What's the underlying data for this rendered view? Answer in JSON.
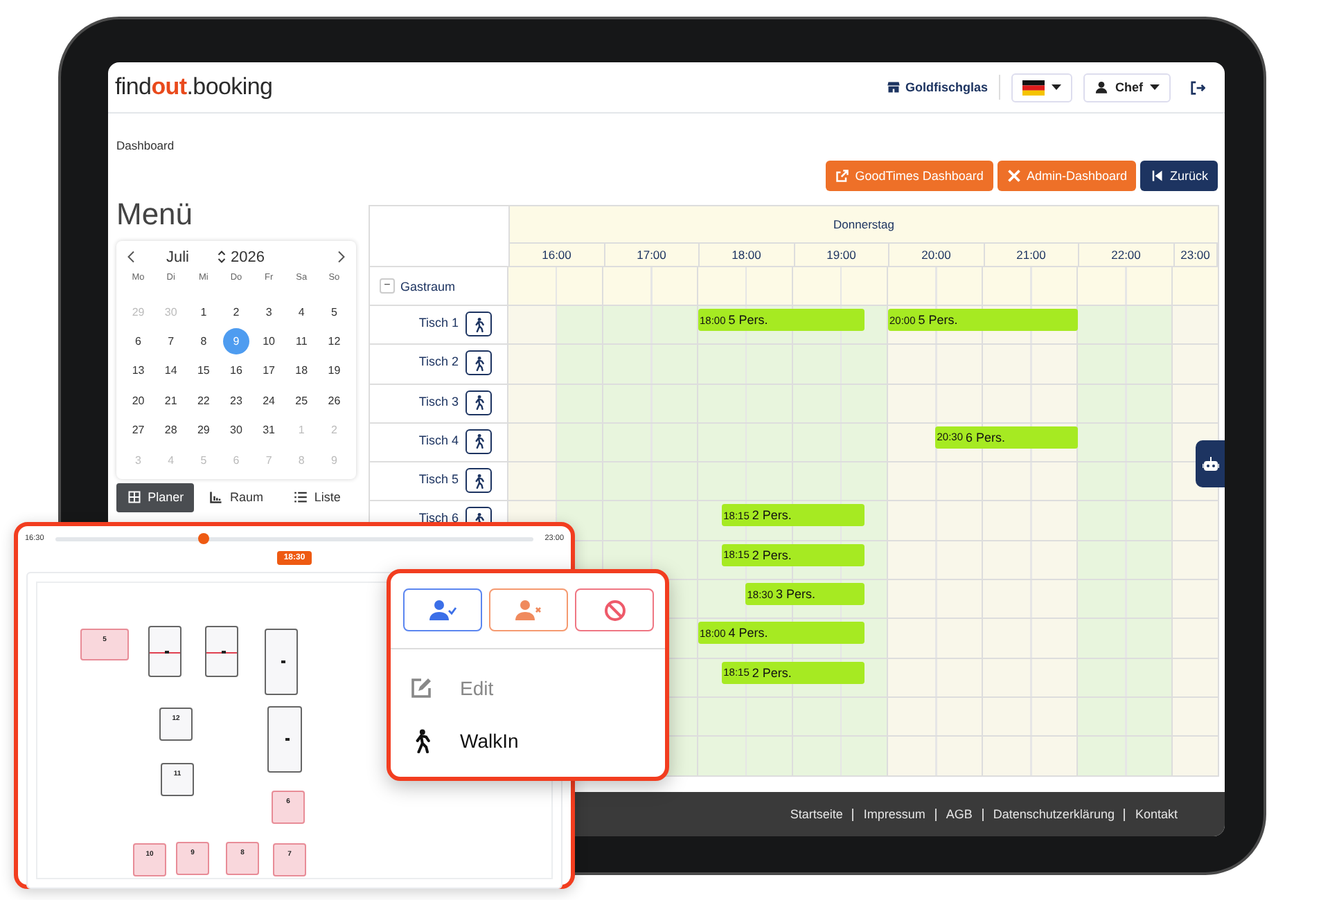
{
  "header": {
    "logo": [
      {
        "text": "find",
        "accent": false
      },
      {
        "text": "out",
        "accent": true
      },
      {
        "text": ".booking",
        "accent": false
      }
    ],
    "location": "Goldfischglas",
    "user": "Chef"
  },
  "breadcrumb": "Dashboard",
  "actions": [
    {
      "label": "GoodTimes Dashboard",
      "kind": "external"
    },
    {
      "label": "Admin-Dashboard",
      "kind": "admin"
    },
    {
      "label": "Zurück",
      "kind": "back"
    }
  ],
  "menu": {
    "title": "Menü",
    "calendar": {
      "month": "Juli",
      "year": "2026",
      "weekdays": [
        "Mo",
        "Di",
        "Mi",
        "Do",
        "Fr",
        "Sa",
        "So"
      ],
      "weeks": [
        [
          {
            "day": "29",
            "outside": true,
            "selected": false
          },
          {
            "day": "30",
            "outside": true,
            "selected": false
          },
          {
            "day": "1",
            "outside": false,
            "selected": false
          },
          {
            "day": "2",
            "outside": false,
            "selected": false
          },
          {
            "day": "3",
            "outside": false,
            "selected": false
          },
          {
            "day": "4",
            "outside": false,
            "selected": false
          },
          {
            "day": "5",
            "outside": false,
            "selected": false
          }
        ],
        [
          {
            "day": "6",
            "outside": false,
            "selected": false
          },
          {
            "day": "7",
            "outside": false,
            "selected": false
          },
          {
            "day": "8",
            "outside": false,
            "selected": false
          },
          {
            "day": "9",
            "outside": false,
            "selected": true
          },
          {
            "day": "10",
            "outside": false,
            "selected": false
          },
          {
            "day": "11",
            "outside": false,
            "selected": false
          },
          {
            "day": "12",
            "outside": false,
            "selected": false
          }
        ],
        [
          {
            "day": "13",
            "outside": false,
            "selected": false
          },
          {
            "day": "14",
            "outside": false,
            "selected": false
          },
          {
            "day": "15",
            "outside": false,
            "selected": false
          },
          {
            "day": "16",
            "outside": false,
            "selected": false
          },
          {
            "day": "17",
            "outside": false,
            "selected": false
          },
          {
            "day": "18",
            "outside": false,
            "selected": false
          },
          {
            "day": "19",
            "outside": false,
            "selected": false
          }
        ],
        [
          {
            "day": "20",
            "outside": false,
            "selected": false
          },
          {
            "day": "21",
            "outside": false,
            "selected": false
          },
          {
            "day": "22",
            "outside": false,
            "selected": false
          },
          {
            "day": "23",
            "outside": false,
            "selected": false
          },
          {
            "day": "24",
            "outside": false,
            "selected": false
          },
          {
            "day": "25",
            "outside": false,
            "selected": false
          },
          {
            "day": "26",
            "outside": false,
            "selected": false
          }
        ],
        [
          {
            "day": "27",
            "outside": false,
            "selected": false
          },
          {
            "day": "28",
            "outside": false,
            "selected": false
          },
          {
            "day": "29",
            "outside": false,
            "selected": false
          },
          {
            "day": "30",
            "outside": false,
            "selected": false
          },
          {
            "day": "31",
            "outside": false,
            "selected": false
          },
          {
            "day": "1",
            "outside": true,
            "selected": false
          },
          {
            "day": "2",
            "outside": true,
            "selected": false
          }
        ],
        [
          {
            "day": "3",
            "outside": true,
            "selected": false
          },
          {
            "day": "4",
            "outside": true,
            "selected": false
          },
          {
            "day": "5",
            "outside": true,
            "selected": false
          },
          {
            "day": "6",
            "outside": true,
            "selected": false
          },
          {
            "day": "7",
            "outside": true,
            "selected": false
          },
          {
            "day": "8",
            "outside": true,
            "selected": false
          },
          {
            "day": "9",
            "outside": true,
            "selected": false
          }
        ]
      ]
    },
    "views": [
      {
        "label": "Planer",
        "kind": "grid",
        "selected": true
      },
      {
        "label": "Raum",
        "kind": "room",
        "selected": false
      },
      {
        "label": "Liste",
        "kind": "list",
        "selected": false
      }
    ]
  },
  "planner": {
    "day": "Donnerstag",
    "hours": [
      {
        "label": "16:00"
      },
      {
        "label": "17:00"
      },
      {
        "label": "18:00"
      },
      {
        "label": "19:00"
      },
      {
        "label": "20:00"
      },
      {
        "label": "21:00"
      },
      {
        "label": "22:00"
      },
      {
        "label": "23:00"
      }
    ],
    "group": {
      "name": "Gastraum",
      "toggle": "−",
      "expanded": true
    },
    "rows": [
      {
        "name": "Tisch 1",
        "bookings": [
          {
            "time": "18:00",
            "guests": "5 Pers."
          },
          {
            "time": "20:00",
            "guests": "5 Pers."
          }
        ]
      },
      {
        "name": "Tisch 2",
        "bookings": []
      },
      {
        "name": "Tisch 3",
        "bookings": []
      },
      {
        "name": "Tisch 4",
        "bookings": [
          {
            "time": "20:30",
            "guests": "6 Pers."
          }
        ]
      },
      {
        "name": "Tisch 5",
        "bookings": []
      },
      {
        "name": "Tisch 6",
        "bookings": [
          {
            "time": "18:15",
            "guests": "2 Pers."
          }
        ]
      },
      {
        "bookings": [
          {
            "time": "18:15",
            "guests": "2 Pers."
          }
        ]
      },
      {
        "bookings": [
          {
            "time": "18:30",
            "guests": "3 Pers."
          }
        ]
      },
      {
        "bookings": [
          {
            "time": "18:00",
            "guests": "4 Pers."
          }
        ]
      },
      {
        "bookings": [
          {
            "time": "18:15",
            "guests": "2 Pers."
          }
        ]
      },
      {
        "bookings": []
      },
      {
        "bookings": []
      }
    ]
  },
  "footer": [
    "Startseite",
    "Impressum",
    "AGB",
    "Datenschutzerklärung",
    "Kontakt"
  ],
  "floor_plan": {
    "slider": {
      "start": "16:30",
      "end": "23:00",
      "level": 0.31,
      "current": "18:30"
    },
    "tables": [
      {
        "number": "5",
        "occupied": true,
        "kind": "wide"
      },
      {
        "occupied": false,
        "kind": "split"
      },
      {
        "occupied": false,
        "kind": "split"
      },
      {
        "occupied": false,
        "kind": "tall"
      },
      {
        "number": "12",
        "occupied": false,
        "kind": "square"
      },
      {
        "occupied": false,
        "kind": "tall"
      },
      {
        "number": "11",
        "occupied": false,
        "kind": "square"
      },
      {
        "number": "6",
        "occupied": true,
        "kind": "square"
      },
      {
        "number": "10",
        "occupied": true,
        "kind": "square"
      },
      {
        "number": "9",
        "occupied": true,
        "kind": "square"
      },
      {
        "number": "8",
        "occupied": true,
        "kind": "square"
      },
      {
        "number": "7",
        "occupied": true,
        "kind": "square"
      }
    ]
  },
  "popup": {
    "actions": [
      {
        "kind": "confirm"
      },
      {
        "kind": "no_show"
      },
      {
        "kind": "cancel"
      }
    ],
    "items": [
      {
        "label": "Edit",
        "kind": "edit",
        "disabled": true
      },
      {
        "label": "WalkIn",
        "kind": "walkin",
        "disabled": false
      }
    ]
  }
}
